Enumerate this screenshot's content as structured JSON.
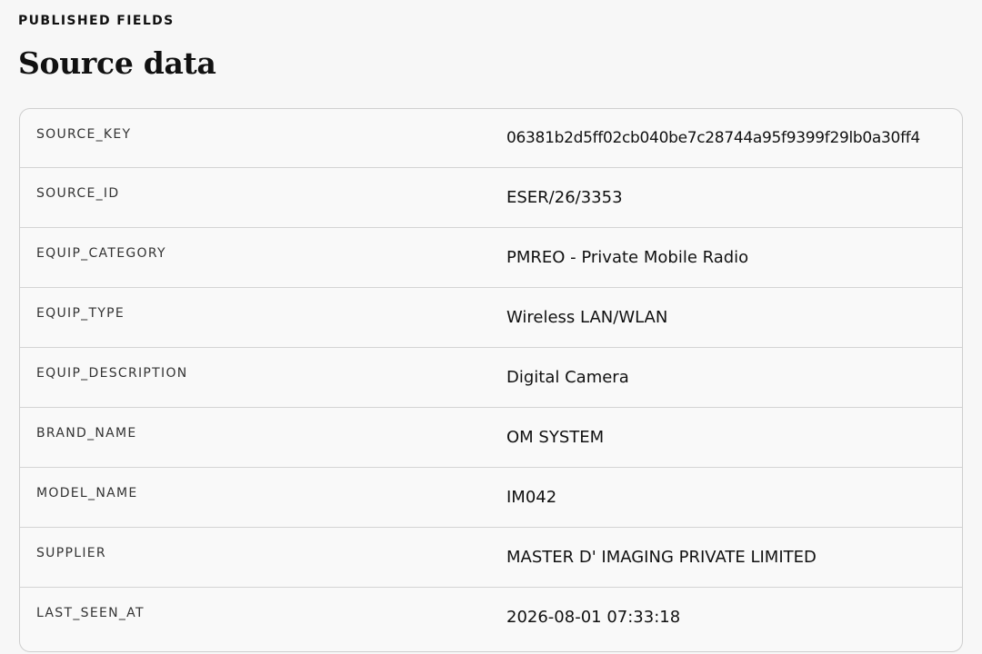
{
  "header": {
    "eyebrow": "PUBLISHED FIELDS",
    "title": "Source data"
  },
  "fields": [
    {
      "key": "SOURCE_KEY",
      "value": "06381b2d5ff02cb040be7c28744a95f9399f29lb0a30ff4"
    },
    {
      "key": "SOURCE_ID",
      "value": "ESER/26/3353"
    },
    {
      "key": "EQUIP_CATEGORY",
      "value": "PMREO - Private Mobile Radio"
    },
    {
      "key": "EQUIP_TYPE",
      "value": "Wireless LAN/WLAN"
    },
    {
      "key": "EQUIP_DESCRIPTION",
      "value": "Digital Camera"
    },
    {
      "key": "BRAND_NAME",
      "value": "OM SYSTEM"
    },
    {
      "key": "MODEL_NAME",
      "value": "IM042"
    },
    {
      "key": "SUPPLIER",
      "value": "MASTER D' IMAGING PRIVATE LIMITED"
    },
    {
      "key": "LAST_SEEN_AT",
      "value": "2026-08-01 07:33:18"
    }
  ]
}
